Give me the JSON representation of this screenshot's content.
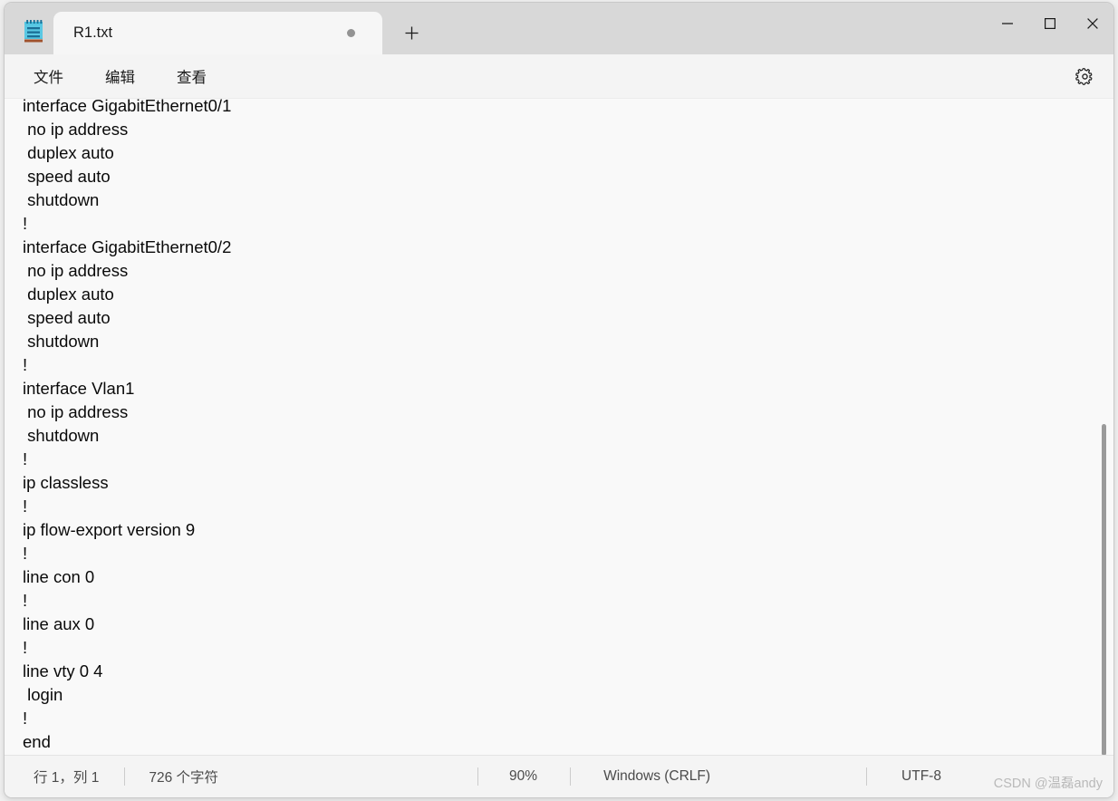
{
  "window": {
    "app_icon": "notepad-icon",
    "controls": {
      "minimize": "minimize-icon",
      "maximize": "maximize-icon",
      "close": "close-icon"
    }
  },
  "tabs": [
    {
      "title": "R1.txt",
      "dirty": true,
      "active": true
    }
  ],
  "new_tab_label": "+",
  "menubar": {
    "items": [
      {
        "label": "文件"
      },
      {
        "label": "编辑"
      },
      {
        "label": "查看"
      }
    ],
    "settings_icon": "gear-icon"
  },
  "editor": {
    "lines": [
      "interface GigabitEthernet0/1",
      " no ip address",
      " duplex auto",
      " speed auto",
      " shutdown",
      "!",
      "interface GigabitEthernet0/2",
      " no ip address",
      " duplex auto",
      " speed auto",
      " shutdown",
      "!",
      "interface Vlan1",
      " no ip address",
      " shutdown",
      "!",
      "ip classless",
      "!",
      "ip flow-export version 9",
      "!",
      "line con 0",
      "!",
      "line aux 0",
      "!",
      "line vty 0 4",
      " login",
      "!",
      "end"
    ]
  },
  "statusbar": {
    "position": "行 1，列 1",
    "characters": "726 个字符",
    "zoom": "90%",
    "line_ending": "Windows (CRLF)",
    "encoding": "UTF-8"
  },
  "watermark": "CSDN @温磊andy",
  "colors": {
    "titlebar": "#d8d8d8",
    "tab_active": "#f6f6f6",
    "editor_bg": "#f9f9f9",
    "text": "#0a0a0a",
    "icon_blue": "#38b6d9",
    "icon_base": "#a0522d"
  }
}
